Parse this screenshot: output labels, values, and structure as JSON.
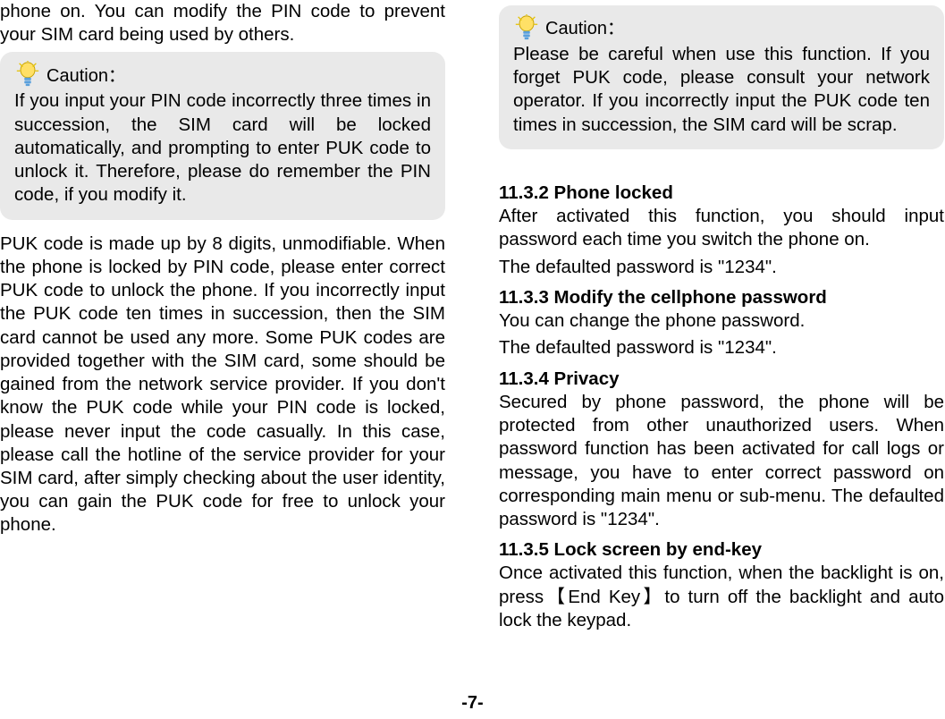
{
  "leftColumn": {
    "intro": "phone on. You can modify the PIN code to prevent your SIM card being used by others.",
    "caution": {
      "label": "Caution：",
      "text": "If you input your PIN code incorrectly three times in succession, the SIM card will be locked automatically, and prompting to enter PUK code to unlock it. Therefore, please do remember the PIN code, if you modify it."
    },
    "pukPara": "PUK code is made up by 8 digits, unmodifiable. When the phone is locked by PIN code, please enter correct PUK code to unlock the phone. If you incorrectly input the PUK code ten times in succession, then the SIM card cannot be used any more. Some PUK codes are provided together with the SIM card, some should be gained from the network service provider. If you don't know the PUK code while your PIN code is locked, please never input the code casually. In this case, please call the hotline of the service provider for your SIM card, after simply checking about the user identity, you can gain the PUK code for free to unlock your phone."
  },
  "rightColumn": {
    "caution": {
      "label": "Caution：",
      "text": "Please be careful when use this function. If you forget PUK code, please consult your network operator. If you incorrectly input the PUK code ten times in succession, the SIM card will be scrap."
    },
    "sections": [
      {
        "heading": "11.3.2 Phone locked",
        "paras": [
          "After activated this function, you should input password each time you switch the phone on.",
          "The defaulted password is \"1234\"."
        ]
      },
      {
        "heading": "11.3.3 Modify the cellphone password",
        "paras": [
          "You can change the phone password.",
          "The defaulted password is \"1234\"."
        ]
      },
      {
        "heading": "11.3.4 Privacy",
        "paras": [
          "Secured by phone password, the phone will be protected from other unauthorized users. When password function has been activated for call logs or message, you have to enter correct password on corresponding main menu or sub-menu. The defaulted password is \"1234\"."
        ]
      },
      {
        "heading": "11.3.5 Lock screen by end-key",
        "paras": [
          "Once activated this function, when the backlight is on, press【End Key】to turn off the backlight and auto lock the keypad."
        ]
      }
    ]
  },
  "pageNumber": "-7-"
}
